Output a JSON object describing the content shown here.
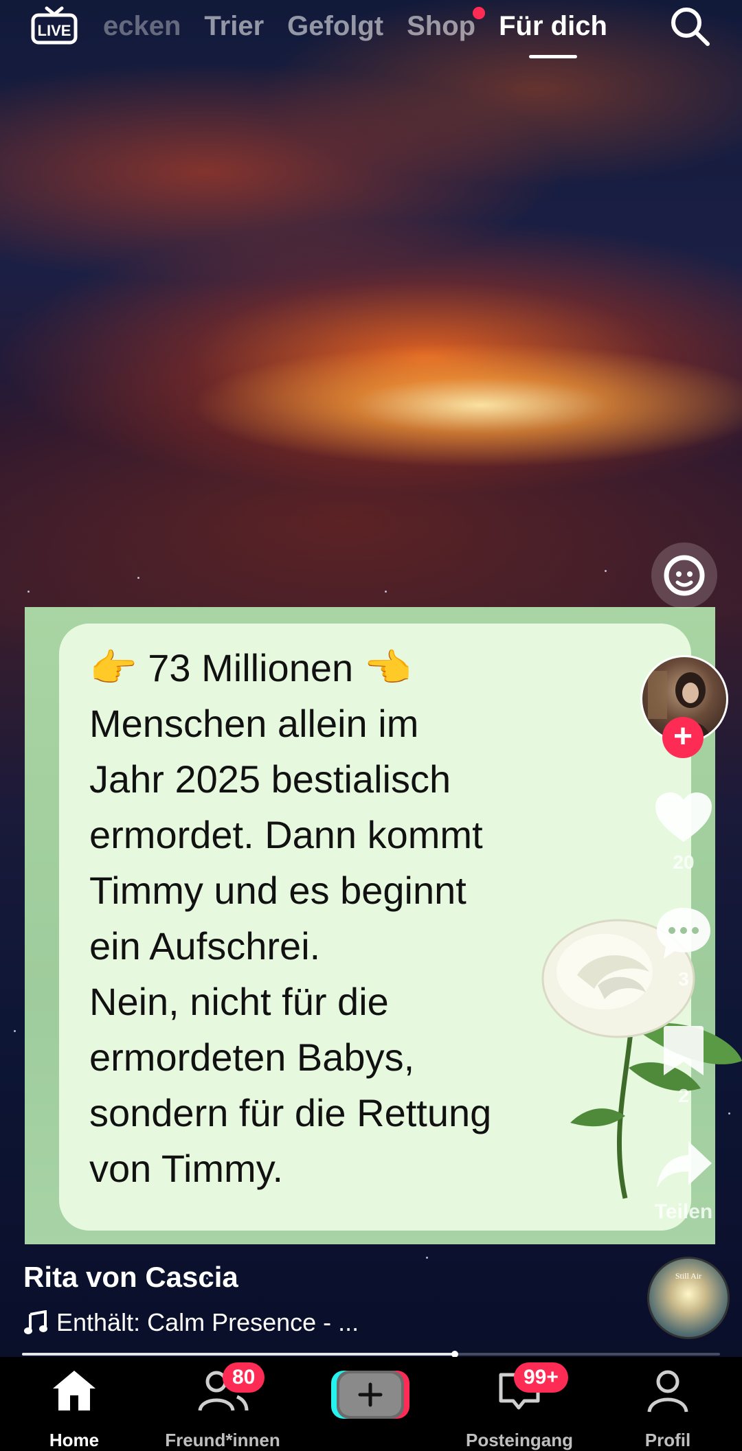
{
  "top_nav": {
    "live_label": "LIVE",
    "tabs": [
      "Entdecken",
      "Trier",
      "Gefolgt",
      "Shop",
      "Für dich"
    ],
    "tabs_visible": [
      "ecken",
      "Trier",
      "Gefolgt",
      "Shop",
      "Für dich"
    ],
    "active_tab": "Für dich"
  },
  "post": {
    "text_lines": [
      "👉 73 Millionen 👈",
      "Menschen allein im",
      "Jahr 2025 bestialisch",
      "ermordet. Dann kommt",
      "Timmy und es beginnt",
      "ein Aufschrei.",
      "Nein, nicht für die",
      "ermordeten Babys,",
      "sondern für die Rettung",
      "von Timmy."
    ],
    "author": "Rita von Cascia",
    "music": "Enthält: Calm Presence - ...",
    "disc_text": "Still Air",
    "progress": 0.62
  },
  "rail": {
    "likes": "20",
    "comments": "3",
    "saves": "2",
    "share_label": "Teilen"
  },
  "bottom_nav": {
    "home": "Home",
    "friends": "Freund*innen",
    "friends_badge": "80",
    "inbox": "Posteingang",
    "inbox_badge": "99+",
    "profile": "Profil"
  },
  "colors": {
    "accent": "#fe2c55",
    "bubble": "#e6f9df",
    "card": "#a9d4a3"
  }
}
